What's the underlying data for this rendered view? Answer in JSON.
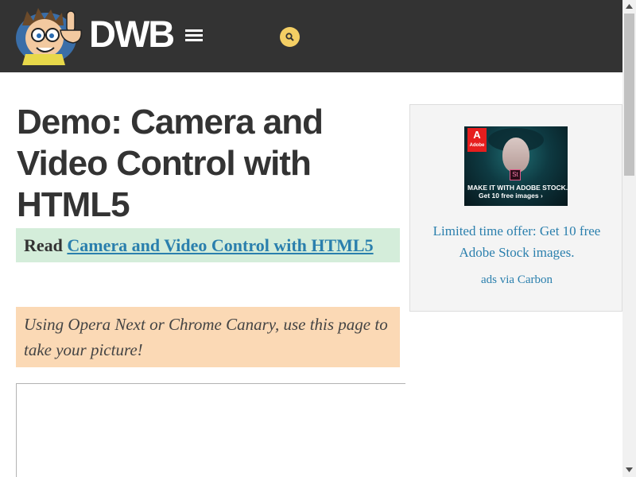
{
  "header": {
    "site_name": "DWB",
    "menu_icon": "hamburger-menu-icon",
    "search_icon": "search-icon",
    "bg_color": "#333333",
    "search_color": "#f4cf64"
  },
  "main": {
    "title": "Demo: Camera and Video Control with HTML5",
    "read_prefix": "Read",
    "read_link": "Camera and Video Control with HTML5",
    "note": "Using Opera Next or Chrome Canary, use this page to take your picture!"
  },
  "ad": {
    "image": {
      "logo_mark": "A",
      "logo_word": "Adobe",
      "product_badge": "St",
      "headline": "MAKE IT WITH ADOBE STOCK.",
      "subline": "Get 10 free images ›"
    },
    "text": "Limited time offer: Get 10 free Adobe Stock images.",
    "via": "ads via Carbon"
  },
  "colors": {
    "link": "#2a7fad",
    "read_box_bg": "#d4edda",
    "note_box_bg": "#fbd9b5",
    "title": "#333333"
  }
}
